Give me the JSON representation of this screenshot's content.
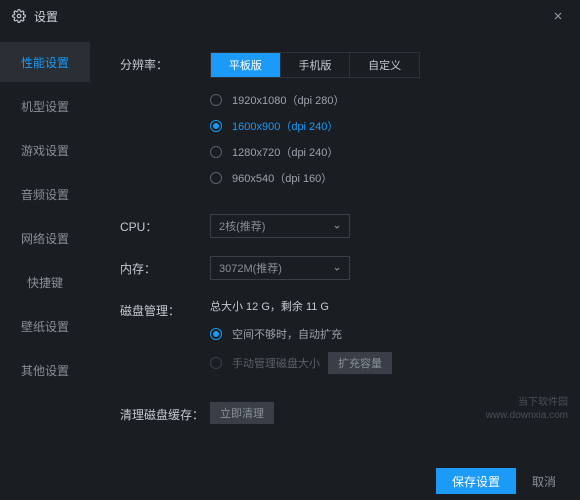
{
  "titlebar": {
    "title": "设置"
  },
  "sidebar": {
    "items": [
      {
        "label": "性能设置",
        "active": true
      },
      {
        "label": "机型设置",
        "active": false
      },
      {
        "label": "游戏设置",
        "active": false
      },
      {
        "label": "音频设置",
        "active": false
      },
      {
        "label": "网络设置",
        "active": false
      },
      {
        "label": "快捷键",
        "active": false
      },
      {
        "label": "壁纸设置",
        "active": false
      },
      {
        "label": "其他设置",
        "active": false
      }
    ]
  },
  "resolution": {
    "label": "分辨率：",
    "tabs": [
      {
        "label": "平板版",
        "active": true
      },
      {
        "label": "手机版",
        "active": false
      },
      {
        "label": "自定义",
        "active": false
      }
    ],
    "options": [
      {
        "label": "1920x1080（dpi 280）",
        "checked": false
      },
      {
        "label": "1600x900（dpi 240）",
        "checked": true
      },
      {
        "label": "1280x720（dpi 240）",
        "checked": false
      },
      {
        "label": "960x540（dpi 160）",
        "checked": false
      }
    ]
  },
  "cpu": {
    "label": "CPU：",
    "value": "2核(推荐)"
  },
  "memory": {
    "label": "内存：",
    "value": "3072M(推荐)"
  },
  "disk": {
    "label": "磁盘管理：",
    "info": "总大小 12 G，剩余 11 G",
    "options": [
      {
        "label": "空间不够时，自动扩充",
        "checked": true,
        "disabled": false
      },
      {
        "label": "手动管理磁盘大小",
        "checked": false,
        "disabled": true
      }
    ],
    "expand_btn": "扩充容量"
  },
  "cache": {
    "label": "清理磁盘缓存：",
    "btn": "立即清理"
  },
  "footer": {
    "save": "保存设置",
    "cancel": "取消"
  },
  "watermark": {
    "line1": "当下软件园",
    "line2": "www.downxia.com"
  }
}
